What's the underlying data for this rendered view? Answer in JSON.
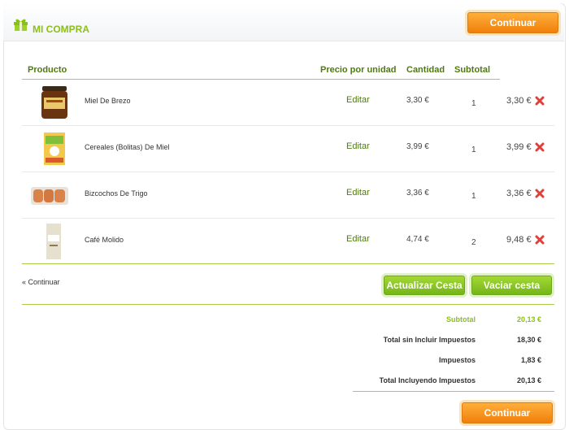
{
  "header": {
    "title": "MI COMPRA",
    "continue_label": "Continuar"
  },
  "table": {
    "headers": {
      "product": "Producto",
      "unit_price": "Precio por unidad",
      "quantity": "Cantidad",
      "subtotal": "Subtotal"
    },
    "rows": [
      {
        "name": "Miel De Brezo",
        "edit": "Editar",
        "price": "3,30 €",
        "qty": "1",
        "subtotal": "3,30 €"
      },
      {
        "name": "Cereales (Bolitas) De Miel",
        "edit": "Editar",
        "price": "3,99 €",
        "qty": "1",
        "subtotal": "3,99 €"
      },
      {
        "name": "Bizcochos De Trigo",
        "edit": "Editar",
        "price": "3,36 €",
        "qty": "1",
        "subtotal": "3,36 €"
      },
      {
        "name": "Café Molido",
        "edit": "Editar",
        "price": "4,74 €",
        "qty": "2",
        "subtotal": "9,48 €"
      }
    ]
  },
  "actions": {
    "back_link": "« Continuar",
    "update_label": "Actualizar Cesta",
    "empty_label": "Vaciar cesta"
  },
  "totals": {
    "subtotal_label": "Subtotal",
    "subtotal_value": "20,13 €",
    "no_tax_label": "Total sin Incluir Impuestos",
    "no_tax_value": "18,30 €",
    "tax_label": "Impuestos",
    "tax_value": "1,83 €",
    "with_tax_label": "Total Incluyendo Impuestos",
    "with_tax_value": "20,13 €"
  },
  "footer": {
    "continue_label": "Continuar"
  },
  "colors": {
    "accent_green": "#8cbf1b",
    "dark_green": "#4f7a10",
    "orange": "#f5901c",
    "delete_red": "#e0403a"
  },
  "icons": {
    "gift": "gift-icon",
    "delete": "delete-x-icon"
  }
}
